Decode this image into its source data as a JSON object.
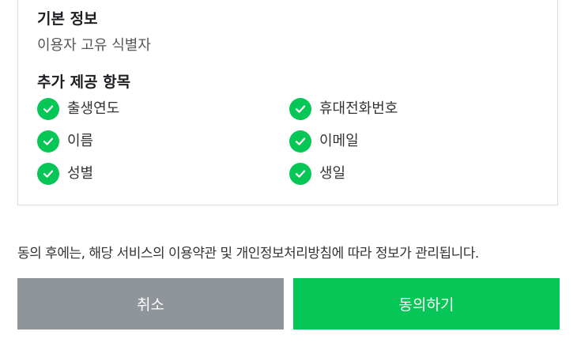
{
  "basic_info": {
    "title": "기본 정보",
    "item": "이용자 고유 식별자"
  },
  "extra_info": {
    "title": "추가 제공 항목",
    "items": [
      {
        "label": "출생연도",
        "checked": true
      },
      {
        "label": "휴대전화번호",
        "checked": true
      },
      {
        "label": "이름",
        "checked": true
      },
      {
        "label": "이메일",
        "checked": true
      },
      {
        "label": "성별",
        "checked": true
      },
      {
        "label": "생일",
        "checked": true
      }
    ]
  },
  "notice": "동의 후에는, 해당 서비스의 이용약관 및 개인정보처리방침에 따라 정보가 관리됩니다.",
  "buttons": {
    "cancel_label": "취소",
    "agree_label": "동의하기"
  },
  "colors": {
    "accent": "#06c755",
    "cancel": "#8f959a"
  }
}
